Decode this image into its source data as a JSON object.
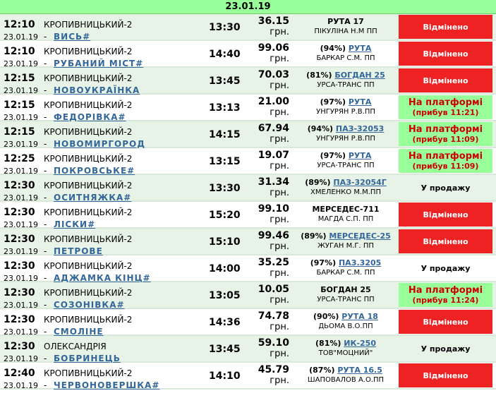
{
  "header": {
    "date": "23.01.19"
  },
  "rows": [
    {
      "time": "12:10",
      "date": "23.01.19",
      "from": "КРОПИВНИЦЬКИЙ-2",
      "to": "ВИСЬ#",
      "arrive": "13:30",
      "price": "36.15",
      "currency": "грн.",
      "pct": "",
      "bus": "РУТА 17",
      "bus_link": false,
      "operator": "ПІКУЛІНА Н.М ПП",
      "status": "cancel",
      "status_text": "Відмінено",
      "status_sub": ""
    },
    {
      "time": "12:10",
      "date": "23.01.19",
      "from": "КРОПИВНИЦЬКИЙ-2",
      "to": "РУБАНИЙ МІСТ#",
      "arrive": "14:40",
      "price": "99.06",
      "currency": "грн.",
      "pct": "(94%)",
      "bus": "РУТА",
      "bus_link": true,
      "operator": "БАРКАР С.М. ПП",
      "status": "cancel",
      "status_text": "Відмінено",
      "status_sub": ""
    },
    {
      "time": "12:15",
      "date": "23.01.19",
      "from": "КРОПИВНИЦЬКИЙ-2",
      "to": "НОВОУКРАЇНКА",
      "arrive": "13:45",
      "price": "70.03",
      "currency": "грн.",
      "pct": "(81%)",
      "bus": "БОГДАН 25",
      "bus_link": true,
      "operator": "УРСА-ТРАНС ПП",
      "status": "cancel",
      "status_text": "Відмінено",
      "status_sub": ""
    },
    {
      "time": "12:15",
      "date": "23.01.19",
      "from": "КРОПИВНИЦЬКИЙ-2",
      "to": "ФЕДОРІВКА#",
      "arrive": "13:13",
      "price": "21.00",
      "currency": "грн.",
      "pct": "(97%)",
      "bus": "РУТА",
      "bus_link": true,
      "operator": "УНГУРЯН Р.В.ПП",
      "status": "platform",
      "status_text": "На платформі",
      "status_sub": "(прибув 11:21)"
    },
    {
      "time": "12:15",
      "date": "23.01.19",
      "from": "КРОПИВНИЦЬКИЙ-2",
      "to": "НОВОМИРГОРОД",
      "arrive": "14:15",
      "price": "67.94",
      "currency": "грн.",
      "pct": "(94%)",
      "bus": "ПАЗ-32053",
      "bus_link": true,
      "operator": "УНГУРЯН Р.В.ПП",
      "status": "platform",
      "status_text": "На платформі",
      "status_sub": "(прибув 11:09)"
    },
    {
      "time": "12:25",
      "date": "23.01.19",
      "from": "КРОПИВНИЦЬКИЙ-2",
      "to": "ПОКРОВСЬКЕ#",
      "arrive": "13:15",
      "price": "19.07",
      "currency": "грн.",
      "pct": "(97%)",
      "bus": "РУТА",
      "bus_link": true,
      "operator": "УРСА-ТРАНС ПП",
      "status": "platform",
      "status_text": "На платформі",
      "status_sub": "(прибув 11:09)"
    },
    {
      "time": "12:30",
      "date": "23.01.19",
      "from": "КРОПИВНИЦЬКИЙ-2",
      "to": "ОСИТНЯЖКА#",
      "arrive": "13:30",
      "price": "31.34",
      "currency": "грн.",
      "pct": "(89%)",
      "bus": "ПАЗ-32054Г",
      "bus_link": true,
      "operator": "ХМЕЛЕНКО М.М.ПП",
      "status": "sale",
      "status_text": "У продажу",
      "status_sub": ""
    },
    {
      "time": "12:30",
      "date": "23.01.19",
      "from": "КРОПИВНИЦЬКИЙ-2",
      "to": "ЛІСКИ#",
      "arrive": "15:20",
      "price": "99.10",
      "currency": "грн.",
      "pct": "",
      "bus": "МЕРСЕДЕС-711",
      "bus_link": false,
      "operator": "МАГДА С.П. ПП",
      "status": "cancel",
      "status_text": "Відмінено",
      "status_sub": ""
    },
    {
      "time": "12:30",
      "date": "23.01.19",
      "from": "КРОПИВНИЦЬКИЙ-2",
      "to": "ПЕТРОВЕ",
      "arrive": "15:10",
      "price": "99.46",
      "currency": "грн.",
      "pct": "(89%)",
      "bus": "МЕРСЕДЕС-25",
      "bus_link": true,
      "operator": "ЖУГАН М.Г. ПП",
      "status": "cancel",
      "status_text": "Відмінено",
      "status_sub": ""
    },
    {
      "time": "12:30",
      "date": "23.01.19",
      "from": "КРОПИВНИЦЬКИЙ-2",
      "to": "АДЖАМКА КІНЦ#",
      "arrive": "14:00",
      "price": "35.25",
      "currency": "грн.",
      "pct": "(97%)",
      "bus": "ПАЗ.3205",
      "bus_link": true,
      "operator": "БАРКАР С.М. ПП",
      "status": "sale",
      "status_text": "У продажу",
      "status_sub": ""
    },
    {
      "time": "12:30",
      "date": "23.01.19",
      "from": "КРОПИВНИЦЬКИЙ-2",
      "to": "СОЗОНІВКА#",
      "arrive": "13:05",
      "price": "10.05",
      "currency": "грн.",
      "pct": "",
      "bus": "БОГДАН 25",
      "bus_link": false,
      "operator": "УРСА-ТРАНС ПП",
      "status": "platform",
      "status_text": "На платформі",
      "status_sub": "(прибув 11:24)"
    },
    {
      "time": "12:30",
      "date": "23.01.19",
      "from": "КРОПИВНИЦЬКИЙ-2",
      "to": "СМОЛІНЕ",
      "arrive": "14:36",
      "price": "74.78",
      "currency": "грн.",
      "pct": "(90%)",
      "bus": "РУТА 18",
      "bus_link": true,
      "operator": "ДЬОМА В.О.ПП",
      "status": "cancel",
      "status_text": "Відмінено",
      "status_sub": ""
    },
    {
      "time": "12:30",
      "date": "23.01.19",
      "from": "ОЛЕКСАНДРІЯ",
      "to": "БОБРИНЕЦЬ",
      "arrive": "13:45",
      "price": "59.10",
      "currency": "грн.",
      "pct": "(81%)",
      "bus": "ИК-250",
      "bus_link": true,
      "operator": "ТОВ\"МОЦНИЙ\"",
      "status": "sale",
      "status_text": "У продажу",
      "status_sub": ""
    },
    {
      "time": "12:40",
      "date": "23.01.19",
      "from": "КРОПИВНИЦЬКИЙ-2",
      "to": "ЧЕРВОНОВЕРШКА#",
      "arrive": "14:10",
      "price": "45.79",
      "currency": "грн.",
      "pct": "(87%)",
      "bus": "РУТА 16.5",
      "bus_link": true,
      "operator": "ШАПОВАЛОВ А.О.ПП",
      "status": "cancel",
      "status_text": "Відмінено",
      "status_sub": ""
    }
  ]
}
